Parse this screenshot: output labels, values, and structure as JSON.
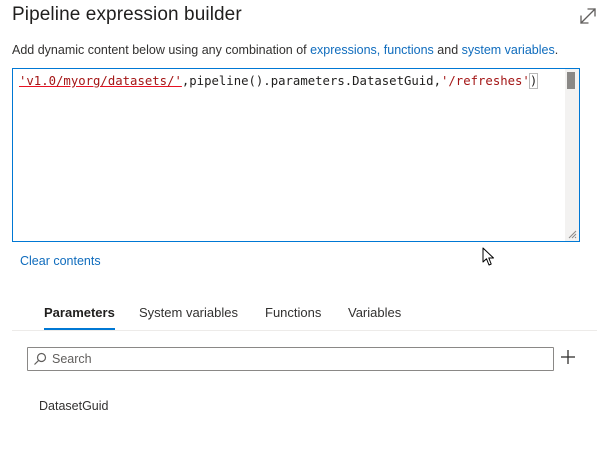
{
  "header": {
    "title": "Pipeline expression builder",
    "expand_icon": "expand-diagonal-icon"
  },
  "hint": {
    "prefix": "Add dynamic content below using any combination of ",
    "link_expressions": "expressions,",
    "link_functions": "functions",
    "conjunction": " and ",
    "link_system_variables": "system variables",
    "suffix": "."
  },
  "editor": {
    "token_string1": "'v1.0/myorg/datasets/'",
    "token_mid": ",pipeline().parameters.DatasetGuid,",
    "token_string2": "'/refreshes'",
    "token_close": ")"
  },
  "clear_contents_label": "Clear contents",
  "tabs": [
    {
      "label": "Parameters",
      "active": true
    },
    {
      "label": "System variables",
      "active": false
    },
    {
      "label": "Functions",
      "active": false
    },
    {
      "label": "Variables",
      "active": false
    }
  ],
  "search": {
    "placeholder": "Search",
    "value": ""
  },
  "add_icon": "plus-icon",
  "parameters": [
    {
      "name": "DatasetGuid"
    }
  ],
  "colors": {
    "accent": "#0078d4",
    "link": "#0f6cbd",
    "string_token": "#a31515",
    "error_underline": "#e81123"
  }
}
